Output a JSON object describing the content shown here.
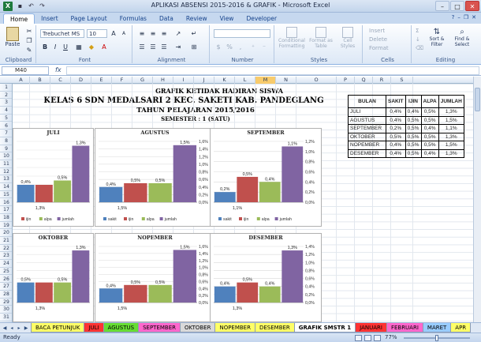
{
  "window": {
    "title": "APLIKASI ABSENSI 2015-2016 & GRAFIK - Microsoft Excel",
    "controls": [
      "–",
      "□",
      "✕"
    ]
  },
  "ribbon_tabs": [
    "Home",
    "Insert",
    "Page Layout",
    "Formulas",
    "Data",
    "Review",
    "View",
    "Developer"
  ],
  "ribbon": {
    "paste_label": "Paste",
    "clipboard_label": "Clipboard",
    "font_name": "Trebuchet MS",
    "font_size": "10",
    "font_label": "Font",
    "alignment_label": "Alignment",
    "number_label": "Number",
    "styles": {
      "conditional": "Conditional Formatting",
      "format_table": "Format as Table",
      "cell_styles": "Cell Styles",
      "label": "Styles"
    },
    "cells": {
      "insert": "Insert",
      "delete": "Delete",
      "format": "Format",
      "label": "Cells"
    },
    "editing": {
      "sum": "Σ",
      "sort": "Sort & Filter",
      "find": "Find & Select",
      "label": "Editing"
    }
  },
  "formula_bar": {
    "name_box": "M40",
    "fx": "fx",
    "value": ""
  },
  "columns": [
    "A",
    "B",
    "C",
    "D",
    "E",
    "F",
    "G",
    "H",
    "I",
    "J",
    "K",
    "L",
    "M",
    "N",
    "O",
    "P",
    "Q",
    "R",
    "S"
  ],
  "selected_column": "M",
  "rows": [
    "1",
    "2",
    "3",
    "4",
    "5",
    "6",
    "7",
    "8",
    "9",
    "10",
    "11",
    "12",
    "13",
    "14",
    "15",
    "16",
    "17",
    "18",
    "19",
    "20",
    "21",
    "22",
    "23",
    "24",
    "25",
    "26",
    "27",
    "28",
    "29",
    "30",
    "31"
  ],
  "sheet": {
    "title1": "GRAFIK KETIDAK HADIRAN SISWA",
    "title2": "KELAS 6 SDN MEDALSARI 2  KEC. SAKETI  KAB. PANDEGLANG",
    "title3": "TAHUN PELAJARAN 2015/2016",
    "title4": "SEMESTER : 1 (SATU)"
  },
  "summary_table": {
    "headers": [
      "BULAN",
      "SAKIT",
      "IJIN",
      "ALPA",
      "JUMLAH"
    ],
    "rows": [
      [
        "JULI",
        "0,4%",
        "0,4%",
        "0,5%",
        "1,3%"
      ],
      [
        "AGUSTUS",
        "0,4%",
        "0,5%",
        "0,5%",
        "1,5%"
      ],
      [
        "SEPTEMBER",
        "0,2%",
        "0,5%",
        "0,4%",
        "1,1%"
      ],
      [
        "OKTOBER",
        "0,5%",
        "0,5%",
        "0,5%",
        "1,3%"
      ],
      [
        "NOPEMBER",
        "0,4%",
        "0,5%",
        "0,5%",
        "1,5%"
      ],
      [
        "DESEMBER",
        "0,4%",
        "0,5%",
        "0,4%",
        "1,3%"
      ]
    ]
  },
  "colors": {
    "sakit": "#4f81bd",
    "ijin": "#c0504d",
    "alpa": "#9bbb59",
    "jumlah": "#8064a2"
  },
  "chart_data": [
    {
      "type": "bar",
      "title": "JULI",
      "categories": [
        "sakit",
        "ijin",
        "alpa",
        "jumlah"
      ],
      "values": [
        0.4,
        0.4,
        0.5,
        1.3
      ],
      "labels": [
        "0,4%",
        "",
        "0,5%",
        "1,3%"
      ],
      "bottom_label": "1,3%",
      "legend_visible": [
        "ijin",
        "alpa",
        "jumlah"
      ],
      "yticks": [],
      "ylim": [
        0,
        1.4
      ]
    },
    {
      "type": "bar",
      "title": "AGUSTUS",
      "categories": [
        "sakit",
        "ijin",
        "alpa",
        "jumlah"
      ],
      "values": [
        0.4,
        0.5,
        0.5,
        1.5
      ],
      "labels": [
        "0,4%",
        "0,5%",
        "0,5%",
        "1,5%"
      ],
      "bottom_label": "1,5%",
      "legend_visible": [
        "sakit",
        "ijin",
        "alpa",
        "jumlah"
      ],
      "yticks": [
        "0,0%",
        "0,2%",
        "0,4%",
        "0,6%",
        "0,8%",
        "1,0%",
        "1,2%",
        "1,4%",
        "1,6%"
      ],
      "ylim": [
        0,
        1.6
      ]
    },
    {
      "type": "bar",
      "title": "SEPTEMBER",
      "categories": [
        "sakit",
        "ijin",
        "alpa",
        "jumlah"
      ],
      "values": [
        0.2,
        0.5,
        0.4,
        1.1
      ],
      "labels": [
        "0,2%",
        "0,5%",
        "0,4%",
        "1,1%"
      ],
      "bottom_label": "1,1%",
      "legend_visible": [
        "sakit",
        "ijin",
        "alpa",
        "jumlah"
      ],
      "yticks": [
        "0,0%",
        "0,2%",
        "0,4%",
        "0,6%",
        "0,8%",
        "1,0%",
        "1,2%"
      ],
      "ylim": [
        0,
        1.2
      ]
    },
    {
      "type": "bar",
      "title": "OKTOBER",
      "categories": [
        "sakit",
        "ijin",
        "alpa",
        "jumlah"
      ],
      "values": [
        0.5,
        0.5,
        0.5,
        1.3
      ],
      "labels": [
        "0,5%",
        "",
        "0,5%",
        "1,3%"
      ],
      "bottom_label": "1,3%",
      "legend_visible": [],
      "yticks": [],
      "ylim": [
        0,
        1.4
      ]
    },
    {
      "type": "bar",
      "title": "NOPEMBER",
      "categories": [
        "sakit",
        "ijin",
        "alpa",
        "jumlah"
      ],
      "values": [
        0.4,
        0.5,
        0.5,
        1.5
      ],
      "labels": [
        "0,4%",
        "0,5%",
        "0,5%",
        "1,5%"
      ],
      "bottom_label": "1,5%",
      "legend_visible": [],
      "yticks": [
        "0,0%",
        "0,2%",
        "0,4%",
        "0,6%",
        "0,8%",
        "1,0%",
        "1,2%",
        "1,4%",
        "1,6%"
      ],
      "ylim": [
        0,
        1.6
      ]
    },
    {
      "type": "bar",
      "title": "DESEMBER",
      "categories": [
        "sakit",
        "ijin",
        "alpa",
        "jumlah"
      ],
      "values": [
        0.4,
        0.5,
        0.4,
        1.3
      ],
      "labels": [
        "0,4%",
        "0,5%",
        "0,4%",
        "1,3%"
      ],
      "bottom_label": "1,3%",
      "legend_visible": [],
      "yticks": [
        "0,0%",
        "0,2%",
        "0,4%",
        "0,6%",
        "0,8%",
        "1,0%",
        "1,2%",
        "1,4%"
      ],
      "ylim": [
        0,
        1.4
      ]
    }
  ],
  "sheet_tabs": [
    "BACA PETUNJUK",
    "JULI",
    "AGUSTUS",
    "SEPTEMBER",
    "OKTOBER",
    "NOPEMBER",
    "DESEMBER",
    "GRAFIK SMSTR 1",
    "JANUARI",
    "FEBRUARI",
    "MARET",
    "APR"
  ],
  "sheet_tab_colors": [
    "#ffff66",
    "#ff3333",
    "#66dd33",
    "#ff66cc",
    "#d9d9d9",
    "#ffff66",
    "#ffff66",
    "#ffffff",
    "#ff3333",
    "#ff66cc",
    "#99ccff",
    "#ffff66"
  ],
  "active_sheet": "GRAFIK SMSTR 1",
  "status": {
    "text": "Ready",
    "zoom": "77%"
  }
}
